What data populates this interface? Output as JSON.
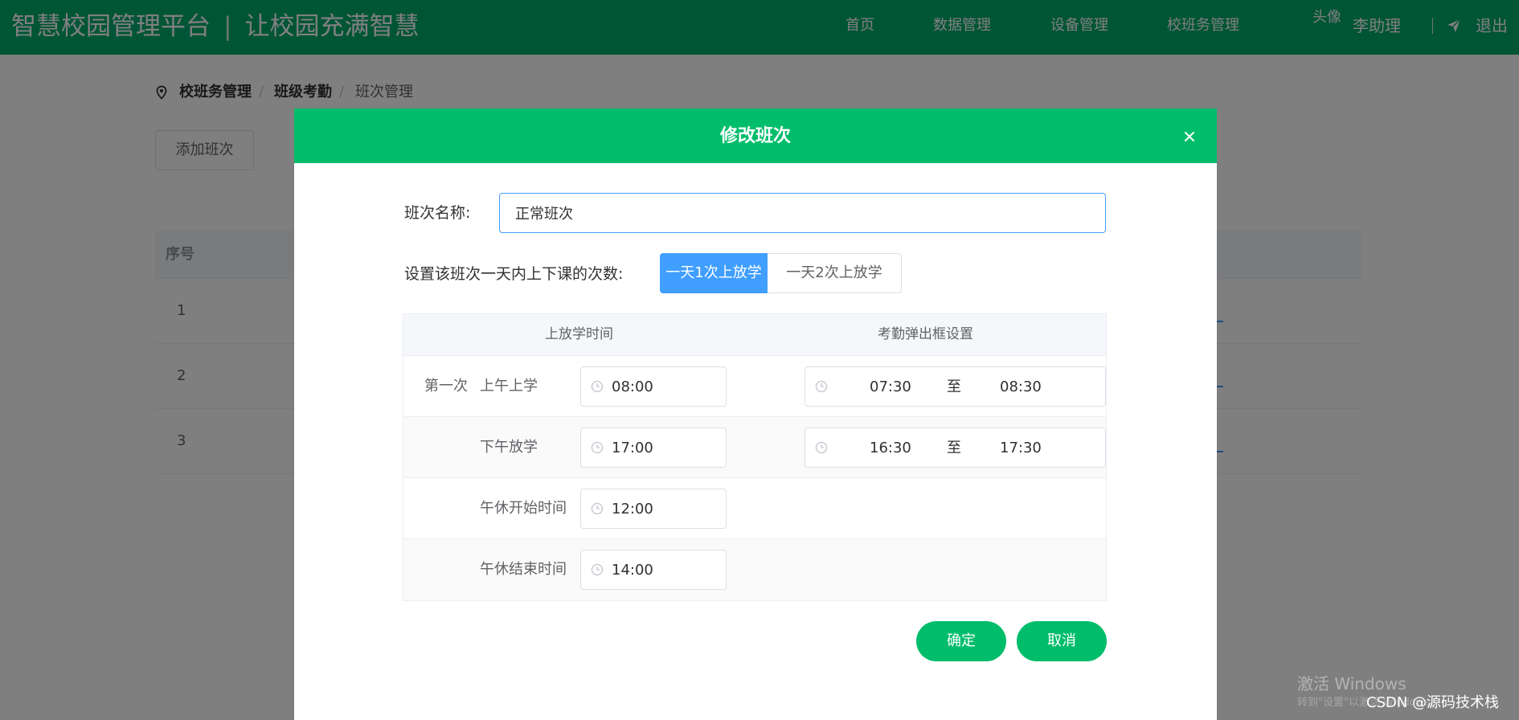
{
  "app": {
    "brand_title": "智慧校园管理平台",
    "brand_separator": "|",
    "brand_slogan": "让校园充满智慧",
    "nav": [
      "首页",
      "数据管理",
      "设备管理",
      "校班务管理"
    ],
    "avatar_alt": "头像",
    "user_name": "李助理",
    "logout_label": "退出"
  },
  "breadcrumb": {
    "items": [
      "校班务管理",
      "班级考勤",
      "班次管理"
    ],
    "separator": "/"
  },
  "page": {
    "add_button": "添加班次",
    "table": {
      "header": "序号",
      "rows": [
        "1",
        "2",
        "3"
      ]
    }
  },
  "dialog": {
    "title": "修改班次",
    "close_icon": "close-icon",
    "name_label": "班次名称:",
    "name_value": "正常班次",
    "count_label": "设置该班次一天内上下课的次数:",
    "count_options": [
      "一天1次上放学",
      "一天2次上放学"
    ],
    "count_selected": "一天1次上放学",
    "time_table": {
      "headers": [
        "上放学时间",
        "考勤弹出框设置"
      ],
      "rows": [
        {
          "prefix": "第一次",
          "label": "上午上学",
          "time": "08:00",
          "range_start": "07:30",
          "range_sep": "至",
          "range_end": "08:30"
        },
        {
          "prefix": "",
          "label": "下午放学",
          "time": "17:00",
          "range_start": "16:30",
          "range_sep": "至",
          "range_end": "17:30"
        },
        {
          "prefix": "",
          "label": "午休开始时间",
          "time": "12:00"
        },
        {
          "prefix": "",
          "label": "午休结束时间",
          "time": "14:00"
        }
      ]
    },
    "confirm_button": "确定",
    "cancel_button": "取消"
  },
  "watermark": {
    "line1": "激活 Windows",
    "line2": "转到\"设置\"以激活 Windows。",
    "credit": "CSDN @源码技术栈"
  },
  "colors": {
    "header": "#00ab6d",
    "dialog_header": "#00bd6b",
    "primary_blue": "#409eff",
    "green_button": "#00bd6b"
  }
}
